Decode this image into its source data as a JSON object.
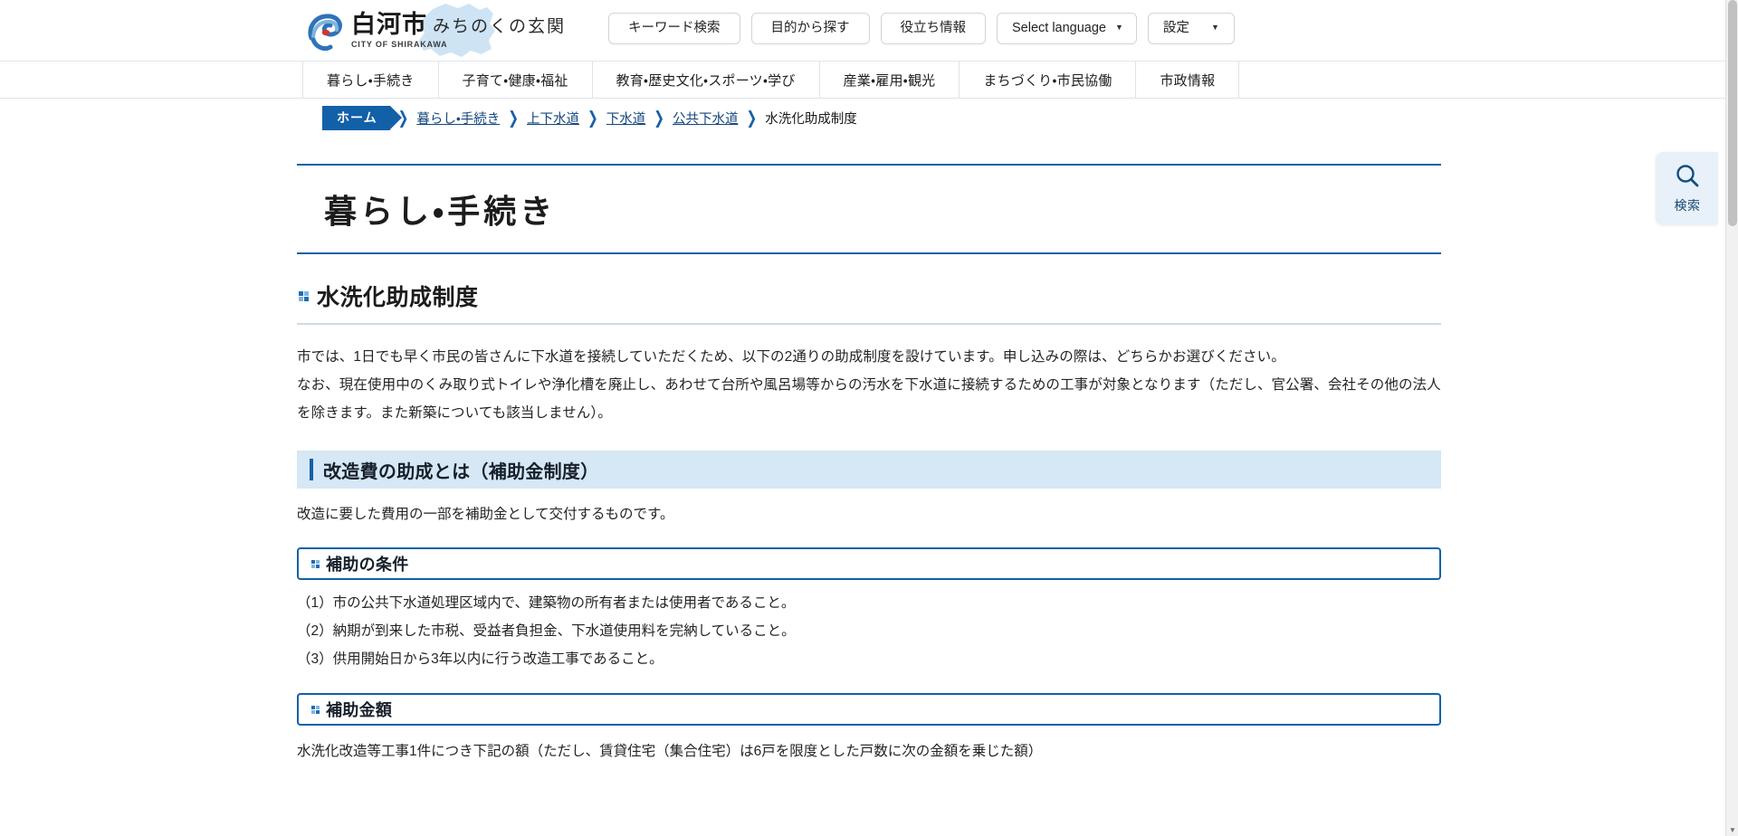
{
  "header": {
    "brand": {
      "name": "白河市",
      "tagline": "みちのくの玄関",
      "english": "CITY OF SHIRAKAWA",
      "logo_icon": "shirakawa-swirl-logo-icon",
      "map_icon": "shirakawa-map-silhouette-icon"
    },
    "buttons": [
      {
        "label": "キーワード検索",
        "icon": "",
        "caret": false
      },
      {
        "label": "目的から探す",
        "icon": "",
        "caret": false
      },
      {
        "label": "役立ち情報",
        "icon": "",
        "caret": false
      },
      {
        "label": "Select language",
        "icon": "chevron-down-icon",
        "caret": true
      },
      {
        "label": "設定",
        "icon": "chevron-down-icon",
        "caret": true
      }
    ]
  },
  "global_nav": {
    "items": [
      "暮らし・手続き",
      "子育て・健康・福祉",
      "教育・歴史文化・スポーツ・学び",
      "産業・雇用・観光",
      "まちづくり・市民協働",
      "市政情報"
    ]
  },
  "breadcrumb": {
    "home_label": "ホーム",
    "separator": "❯",
    "links": [
      "暮らし・手続き",
      "上下水道",
      "下水道",
      "公共下水道"
    ],
    "current": "水洗化助成制度"
  },
  "main": {
    "hero_title": "暮らし・手続き",
    "section_title": "水洗化助成制度",
    "intro_paragraphs": [
      "市では、1日でも早く市民の皆さんに下水道を接続していただくため、以下の2通りの助成制度を設けています。申し込みの際は、どちらかお選びください。",
      "なお、現在使用中のくみ取り式トイレや浄化槽を廃止し、あわせて台所や風呂場等からの汚水を下水道に接続するための工事が対象となります（ただし、官公署、会社その他の法人を除きます。また新築についても該当しません）。"
    ],
    "h3_title": "改造費の助成とは（補助金制度）",
    "h3_para": "改造に要した費用の一部を補助金として交付するものです。",
    "h4_conditions_title": "補助の条件",
    "conditions": [
      "（1）市の公共下水道処理区域内で、建築物の所有者または使用者であること。",
      "（2）納期が到来した市税、受益者負担金、下水道使用料を完納していること。",
      "（3）供用開始日から3年以内に行う改造工事であること。"
    ],
    "h4_amount_title": "補助金額",
    "amount_para": "水洗化改造等工事1件につき下記の額（ただし、賃貸住宅（集合住宅）は6戸を限度とした戸数に次の金額を乗じた額）"
  },
  "search_tab": {
    "label": "検索",
    "icon": "search-icon"
  },
  "colors": {
    "brand_blue": "#1260a8",
    "band_blue": "#d6e7f5",
    "link_blue": "#14477e",
    "search_tab_bg": "#e8f1f9"
  }
}
